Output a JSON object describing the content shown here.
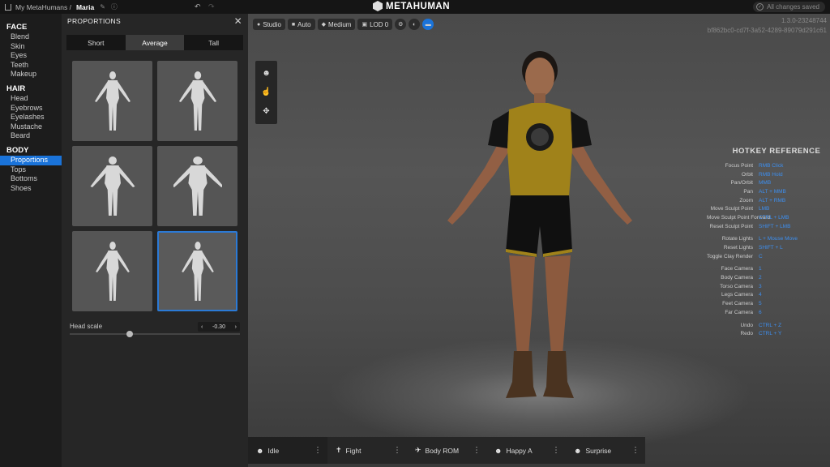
{
  "topbar": {
    "breadcrumb_root": "My MetaHumans /",
    "character_name": "Maria",
    "logo_text": "METAHUMAN",
    "saved_status": "All changes saved"
  },
  "nav": {
    "sections": [
      {
        "title": "FACE",
        "items": [
          "Blend",
          "Skin",
          "Eyes",
          "Teeth",
          "Makeup"
        ]
      },
      {
        "title": "HAIR",
        "items": [
          "Head",
          "Eyebrows",
          "Eyelashes",
          "Mustache",
          "Beard"
        ]
      },
      {
        "title": "BODY",
        "items": [
          "Proportions",
          "Tops",
          "Bottoms",
          "Shoes"
        ]
      }
    ],
    "active_item": "Proportions"
  },
  "panel": {
    "title": "PROPORTIONS",
    "segments": [
      "Short",
      "Average",
      "Tall"
    ],
    "selected_segment": "Average",
    "selected_thumbnail": 5,
    "head_scale_label": "Head scale",
    "head_scale_value": "-0.30"
  },
  "viewport": {
    "toolbar": [
      {
        "icon": "lightbulb-icon",
        "label": "Studio"
      },
      {
        "icon": "camera-icon",
        "label": "Auto"
      },
      {
        "icon": "diamond-icon",
        "label": "Medium"
      },
      {
        "icon": "layers-icon",
        "label": "LOD 0"
      }
    ],
    "version": "1.3.0-23248744",
    "guid": "bf862bc0-cd7f-3a52-4289-89079d291c61"
  },
  "hotkeys": {
    "title": "HOTKEY REFERENCE",
    "groups": [
      [
        {
          "action": "Focus Point",
          "key": "RMB Click"
        },
        {
          "action": "Orbit",
          "key": "RMB Hold"
        },
        {
          "action": "Pan/Orbit",
          "key": "MMB"
        },
        {
          "action": "Pan",
          "key": "ALT + MMB"
        },
        {
          "action": "Zoom",
          "key": "ALT + RMB"
        },
        {
          "action": "Move Sculpt Point",
          "key": "LMB"
        },
        {
          "action": "Move Sculpt Point Forward",
          "key": "CTRL + LMB"
        },
        {
          "action": "Reset Sculpt Point",
          "key": "SHIFT + LMB"
        }
      ],
      [
        {
          "action": "Rotate Lights",
          "key": "L + Mouse Move"
        },
        {
          "action": "Reset Lights",
          "key": "SHIFT + L"
        },
        {
          "action": "Toggle Clay Render",
          "key": "C"
        }
      ],
      [
        {
          "action": "Face Camera",
          "key": "1"
        },
        {
          "action": "Body Camera",
          "key": "2"
        },
        {
          "action": "Torso Camera",
          "key": "3"
        },
        {
          "action": "Legs Camera",
          "key": "4"
        },
        {
          "action": "Feet Camera",
          "key": "5"
        },
        {
          "action": "Far Camera",
          "key": "6"
        }
      ],
      [
        {
          "action": "Undo",
          "key": "CTRL + Z"
        },
        {
          "action": "Redo",
          "key": "CTRL + Y"
        }
      ]
    ]
  },
  "animations": [
    {
      "label": "Idle",
      "icon": "mask-icon"
    },
    {
      "label": "Fight",
      "icon": "figure-icon"
    },
    {
      "label": "Body ROM",
      "icon": "running-icon"
    },
    {
      "label": "Happy A",
      "icon": "mask-icon"
    },
    {
      "label": "Surprise",
      "icon": "mask-icon"
    }
  ],
  "colors": {
    "accent": "#1a73d9",
    "hotkey_value": "#3d8ff0",
    "shirt": "#a0821a"
  }
}
